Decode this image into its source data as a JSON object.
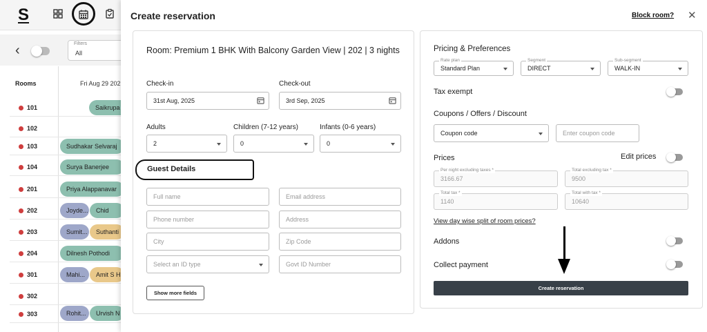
{
  "app": {
    "logo": "S"
  },
  "background": {
    "filter": {
      "label": "Filters",
      "value": "All"
    },
    "rooms_header": "Rooms",
    "date_header": "Fri Aug 29 202",
    "rooms": [
      "101",
      "102",
      "103",
      "104",
      "201",
      "202",
      "203",
      "204",
      "301",
      "302",
      "303"
    ],
    "bookings": [
      {
        "label": "Saikrupa",
        "color": "#8dbfaf"
      },
      {
        "label": "Sudhakar Selvaraj",
        "color": "#8dbfaf"
      },
      {
        "label": "Surya Banerjee",
        "color": "#8dbfaf"
      },
      {
        "label": "Priya Alappanavar",
        "color": "#8dbfaf"
      },
      {
        "label": "Joyde...",
        "color": "#9ea7c9"
      },
      {
        "label": "Chid",
        "color": "#8dbfaf"
      },
      {
        "label": "Sumit...",
        "color": "#9ea7c9"
      },
      {
        "label": "Suthanti",
        "color": "#e9c88a"
      },
      {
        "label": "Dilnesh Pothodi",
        "color": "#8dbfaf"
      },
      {
        "label": "Mahi...",
        "color": "#9ea7c9"
      },
      {
        "label": "Amit S H",
        "color": "#e9c88a"
      },
      {
        "label": "Rohit...",
        "color": "#9ea7c9"
      },
      {
        "label": "Urvish N",
        "color": "#8dbfaf"
      }
    ]
  },
  "modal": {
    "title": "Create reservation",
    "block_room": "Block room?",
    "close": "✕",
    "room_title": "Room: Premium 1 BHK With Balcony Garden View | 202 | 3 nights",
    "checkin": {
      "label": "Check-in",
      "value": "31st Aug, 2025"
    },
    "checkout": {
      "label": "Check-out",
      "value": "3rd Sep, 2025"
    },
    "adults": {
      "label": "Adults",
      "value": "2"
    },
    "children": {
      "label": "Children (7-12 years)",
      "value": "0"
    },
    "infants": {
      "label": "Infants (0-6 years)",
      "value": "0"
    },
    "guest_details": {
      "title": "Guest Details",
      "full_name": "Full name",
      "email": "Email address",
      "phone": "Phone number",
      "address": "Address",
      "city": "City",
      "zip": "Zip Code",
      "id_type": "Select an ID type",
      "govt_id": "Govt ID Number",
      "show_more": "Show more fields"
    },
    "pricing": {
      "title": "Pricing & Preferences",
      "rate_plan": {
        "label": "Rate plan",
        "value": "Standard Plan"
      },
      "segment": {
        "label": "Segment",
        "value": "DIRECT"
      },
      "sub_segment": {
        "label": "Sub-segment",
        "value": "WALK-IN"
      },
      "tax_exempt": "Tax exempt",
      "coupons_title": "Coupons / Offers / Discount",
      "coupon_select": "Coupon code",
      "coupon_input": "Enter coupon code",
      "prices_title": "Prices",
      "edit_prices": "Edit prices",
      "per_night": {
        "label": "Per night excluding taxes *",
        "value": "3166.67"
      },
      "total_ex_tax": {
        "label": "Total excluding tax *",
        "value": "9500"
      },
      "total_tax": {
        "label": "Total tax *",
        "value": "1140"
      },
      "total_with_tax": {
        "label": "Total with tax *",
        "value": "10640"
      },
      "day_wise_link": "View day wise split of room prices?",
      "addons": "Addons",
      "collect_payment": "Collect payment",
      "create_button": "Create reservation"
    }
  }
}
